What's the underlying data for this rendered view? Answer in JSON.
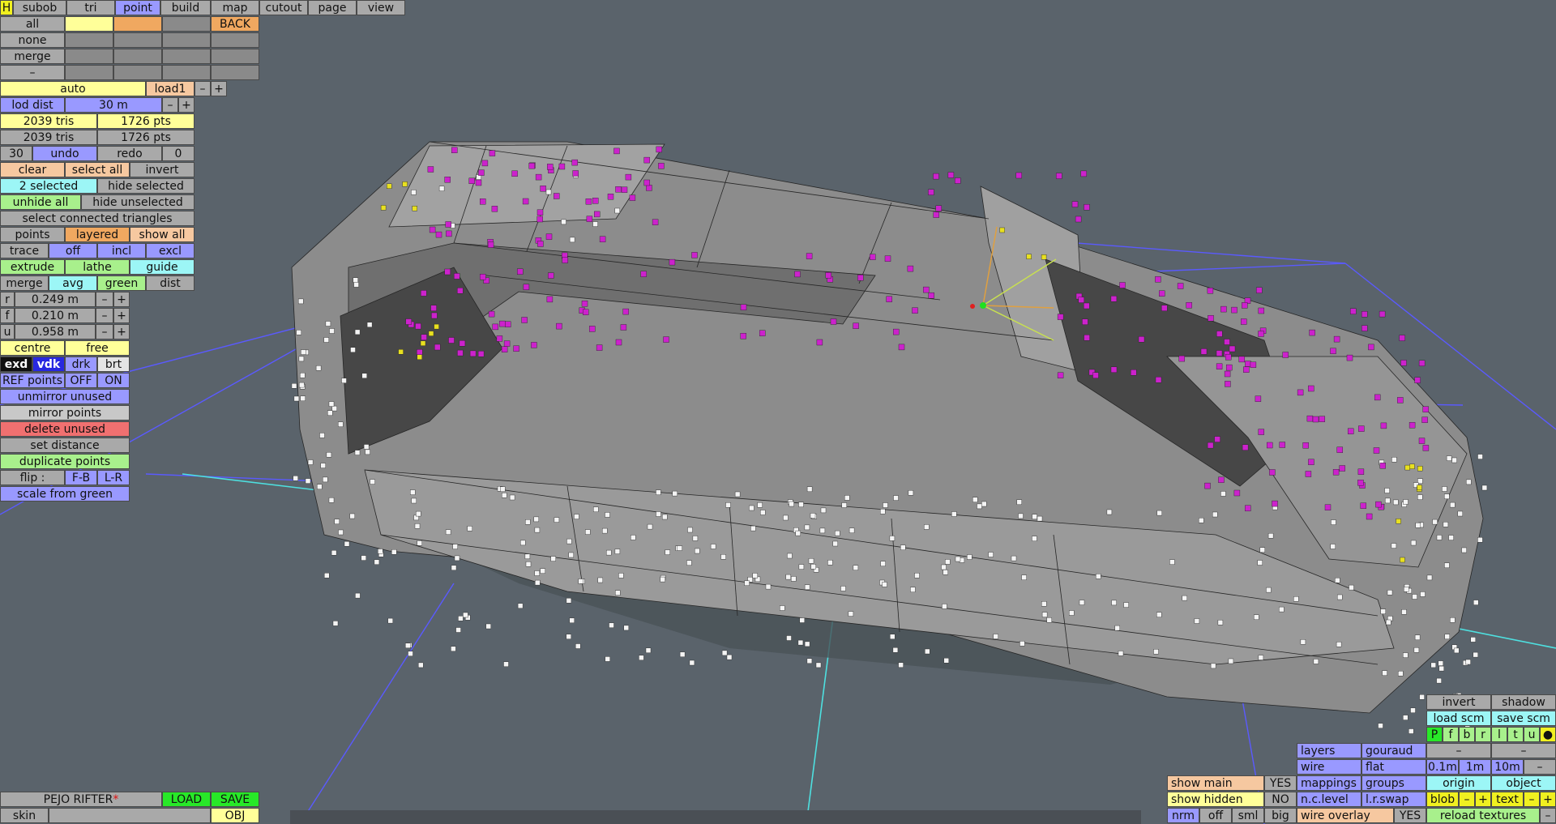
{
  "top_tabs": [
    "H",
    "subob",
    "tri",
    "point",
    "build",
    "map",
    "cutout",
    "page",
    "view"
  ],
  "select_rows": {
    "all": "all",
    "none": "none",
    "merge": "merge",
    "dash": "–",
    "back": "BACK"
  },
  "lod": {
    "auto": "auto",
    "level": "load1",
    "minus": "–",
    "plus": "+",
    "dist_label": "lod dist",
    "dist_value": "30 m"
  },
  "stats": [
    {
      "tris": "2039 tris",
      "pts": "1726 pts"
    },
    {
      "tris": "2039 tris",
      "pts": "1726 pts"
    }
  ],
  "undo": {
    "count": "30",
    "undo": "undo",
    "redo": "redo",
    "redo_count": "0"
  },
  "selection": {
    "clear": "clear",
    "select_all": "select all",
    "invert": "invert",
    "selected": "2 selected",
    "hide_selected": "hide selected",
    "unhide_all": "unhide all",
    "hide_unselected": "hide unselected",
    "select_connected": "select connected triangles"
  },
  "view_modes": {
    "points": "points",
    "layered": "layered",
    "show_all": "show all"
  },
  "trace": {
    "label": "trace",
    "off": "off",
    "incl": "incl",
    "excl": "excl"
  },
  "tools": {
    "extrude": "extrude",
    "lathe": "lathe",
    "guide": "guide",
    "merge": "merge",
    "avg": "avg",
    "green": "green",
    "dist": "dist"
  },
  "rfu": [
    {
      "k": "r",
      "v": "0.249 m"
    },
    {
      "k": "f",
      "v": "0.210 m"
    },
    {
      "k": "u",
      "v": "0.958 m"
    }
  ],
  "centre": {
    "centre": "centre",
    "free": "free"
  },
  "shade": {
    "exd": "exd",
    "vdk": "vdk",
    "drk": "drk",
    "brt": "brt"
  },
  "ref": {
    "label": "REF points",
    "off": "OFF",
    "on": "ON"
  },
  "actions": [
    "unmirror unused",
    "mirror points",
    "delete unused",
    "set distance",
    "duplicate points"
  ],
  "flip": {
    "label": "flip :",
    "fb": "F-B",
    "lr": "L-R"
  },
  "scale_from_green": "scale from green",
  "bottom_left": {
    "name": "PEJO RIFTER",
    "star": "*",
    "load": "LOAD",
    "save": "SAVE",
    "skin": "skin",
    "obj": "OBJ"
  },
  "br": {
    "invert": "invert",
    "shadow": "shadow",
    "load_scm": "load scm",
    "save_scm": "save scm",
    "views": [
      "P",
      "f",
      "b",
      "r",
      "l",
      "t",
      "u",
      "●"
    ],
    "dash": "–",
    "layers": "layers",
    "gouraud": "gouraud",
    "wire": "wire",
    "flat": "flat",
    "scales": [
      "0.1m",
      "1m",
      "10m",
      "–"
    ],
    "show_main": "show main",
    "yes": "YES",
    "mappings": "mappings",
    "groups": "groups",
    "origin": "origin",
    "object": "object",
    "show_hidden": "show hidden",
    "no": "NO",
    "nc_level": "n.c.level",
    "lr_swap": "l.r.swap",
    "blob": "blob",
    "minus": "–",
    "plus": "+",
    "text": "text",
    "nrm": "nrm",
    "off": "off",
    "sml": "sml",
    "big": "big",
    "wire_overlay": "wire overlay",
    "reload": "reload textures"
  },
  "colors": {
    "bg": "#5a636b",
    "mesh": "#8c8c8c",
    "magenta": "#cc22cc",
    "grid": "#5a5aff",
    "axis": "#4ee0e0"
  }
}
